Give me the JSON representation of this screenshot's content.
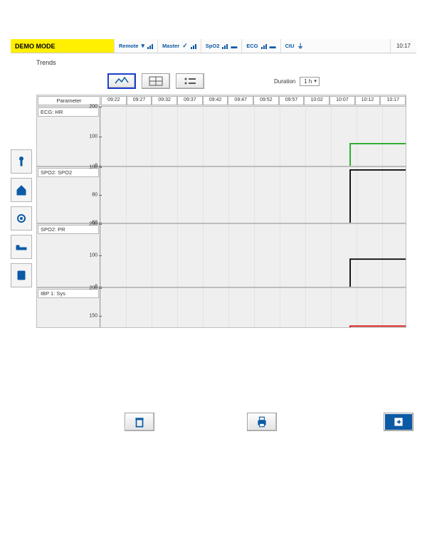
{
  "header": {
    "mode_label": "DEMO MODE",
    "segments": [
      {
        "name": "Remote"
      },
      {
        "name": "Master"
      },
      {
        "name": "SpO2"
      },
      {
        "name": "ECG"
      },
      {
        "name": "CIU"
      }
    ],
    "clock": "10:17"
  },
  "sidebar_icons": [
    "patient-icon",
    "home-icon",
    "settings-icon",
    "bed-icon",
    "clipboard-icon"
  ],
  "title": "Trends",
  "toolbar": {
    "view_graph": "graph",
    "view_table": "table",
    "view_list": "list",
    "active": "graph",
    "duration_label": "Duration",
    "duration_value": "1 h"
  },
  "time_axis": [
    "09:22",
    "09:27",
    "09:32",
    "09:37",
    "09:42",
    "09:47",
    "09:52",
    "09:57",
    "10:02",
    "10:07",
    "10:12",
    "10:17"
  ],
  "parameter_col_header": "Parameter",
  "colors": {
    "ecg_hr": "#1aa51a",
    "spo2": "#000000",
    "spo2_pr": "#000000",
    "ibp_sys": "#d40000"
  },
  "chart_data": [
    {
      "type": "line",
      "parameter": "ECG: HR",
      "ylim": [
        0,
        200
      ],
      "yticks": [
        0,
        100,
        200
      ],
      "x": [
        "09:22",
        "09:27",
        "09:32",
        "09:37",
        "09:42",
        "09:47",
        "09:52",
        "09:57",
        "10:02",
        "10:07",
        "10:12",
        "10:17"
      ],
      "values": [
        null,
        null,
        null,
        null,
        null,
        null,
        null,
        null,
        null,
        75,
        75,
        75
      ],
      "color": "#1aa51a"
    },
    {
      "type": "line",
      "parameter": "SPO2: SPO2",
      "ylim": [
        60,
        100
      ],
      "yticks": [
        60,
        80,
        100
      ],
      "x": [
        "09:22",
        "09:27",
        "09:32",
        "09:37",
        "09:42",
        "09:47",
        "09:52",
        "09:57",
        "10:02",
        "10:07",
        "10:12",
        "10:17"
      ],
      "values": [
        null,
        null,
        null,
        null,
        null,
        null,
        null,
        null,
        null,
        98,
        98,
        98
      ],
      "color": "#000000"
    },
    {
      "type": "line",
      "parameter": "SPO2: PR",
      "ylim": [
        0,
        200
      ],
      "yticks": [
        0,
        100,
        200
      ],
      "x": [
        "09:22",
        "09:27",
        "09:32",
        "09:37",
        "09:42",
        "09:47",
        "09:52",
        "09:57",
        "10:02",
        "10:07",
        "10:12",
        "10:17"
      ],
      "values": [
        null,
        null,
        null,
        null,
        null,
        null,
        null,
        null,
        null,
        88,
        88,
        88
      ],
      "color": "#000000"
    },
    {
      "type": "line",
      "parameter": "IBP 1: Sys",
      "ylim": [
        130,
        200
      ],
      "yticks": [
        150,
        200
      ],
      "x": [
        "09:22",
        "09:27",
        "09:32",
        "09:37",
        "09:42",
        "09:47",
        "09:52",
        "09:57",
        "10:02",
        "10:07",
        "10:12",
        "10:17"
      ],
      "values": [
        null,
        null,
        null,
        null,
        null,
        null,
        null,
        null,
        null,
        132,
        132,
        132
      ],
      "color": "#d40000"
    }
  ],
  "footer": {
    "delete": "delete",
    "print": "print",
    "export": "export"
  }
}
